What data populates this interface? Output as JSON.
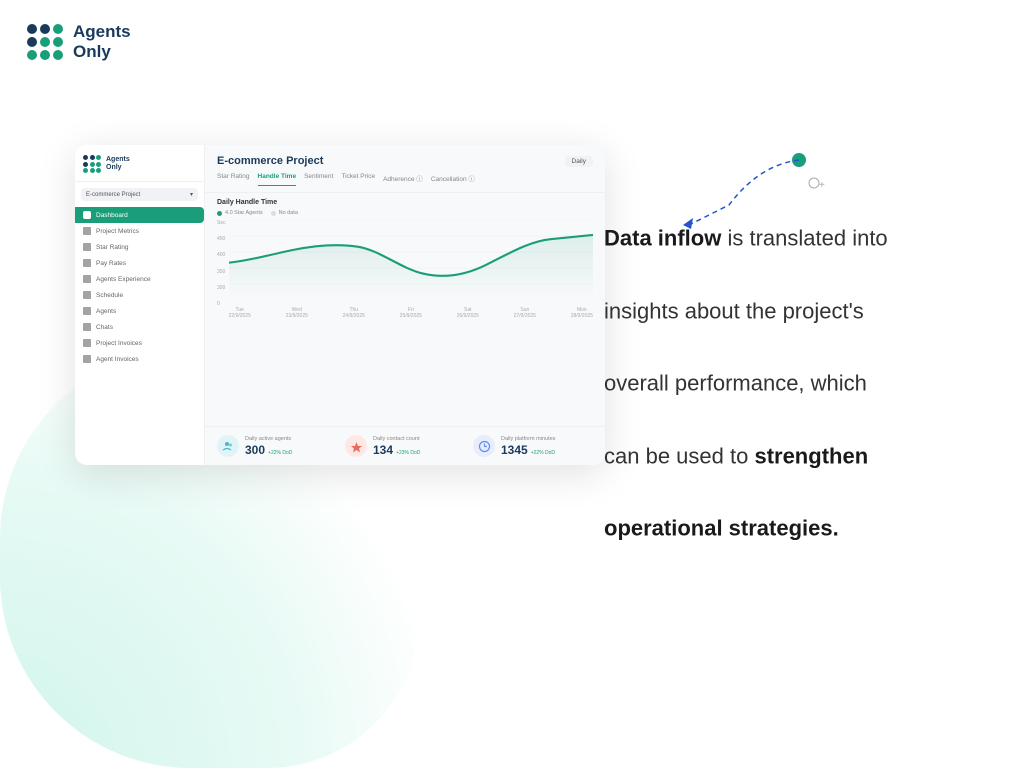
{
  "brand": {
    "name_line1": "Agents",
    "name_line2": "Only"
  },
  "mockup": {
    "title": "E-commerce Project",
    "daily_label": "Daily",
    "project_select": "E-commerce Project",
    "tabs": [
      "Star Rating",
      "Handle Time",
      "Sentiment",
      "Ticket Price",
      "Adherence ⓘ",
      "Cancellation ⓘ"
    ],
    "active_tab": "Handle Time",
    "chart_title": "Daily Handle Time",
    "legend": [
      "4.0 Star Agents",
      "No data"
    ],
    "nav_items": [
      "Dashboard",
      "Project Metrics",
      "Star Rating",
      "Pay Rates",
      "Agents Experience",
      "Schedule",
      "Agents",
      "Chats",
      "Project Invoices",
      "Agent Invoices"
    ],
    "active_nav": "Dashboard",
    "stats": [
      {
        "label": "Daily active agents",
        "value": "300",
        "change": "+22% DoD",
        "color": "#4ab8c8",
        "icon": "👥"
      },
      {
        "label": "Daily contact count",
        "value": "134",
        "change": "+23% DoD",
        "color": "#e86c5d",
        "icon": "⭐"
      },
      {
        "label": "Daily platform minutes",
        "value": "1345",
        "change": "+22% DoD",
        "color": "#5b8df5",
        "icon": "⏱"
      }
    ]
  },
  "tagline": {
    "part1": "Data inflow",
    "part2": " is translated into insights about the project's overall performance, which can be used to ",
    "part3": "strengthen operational strategies."
  }
}
